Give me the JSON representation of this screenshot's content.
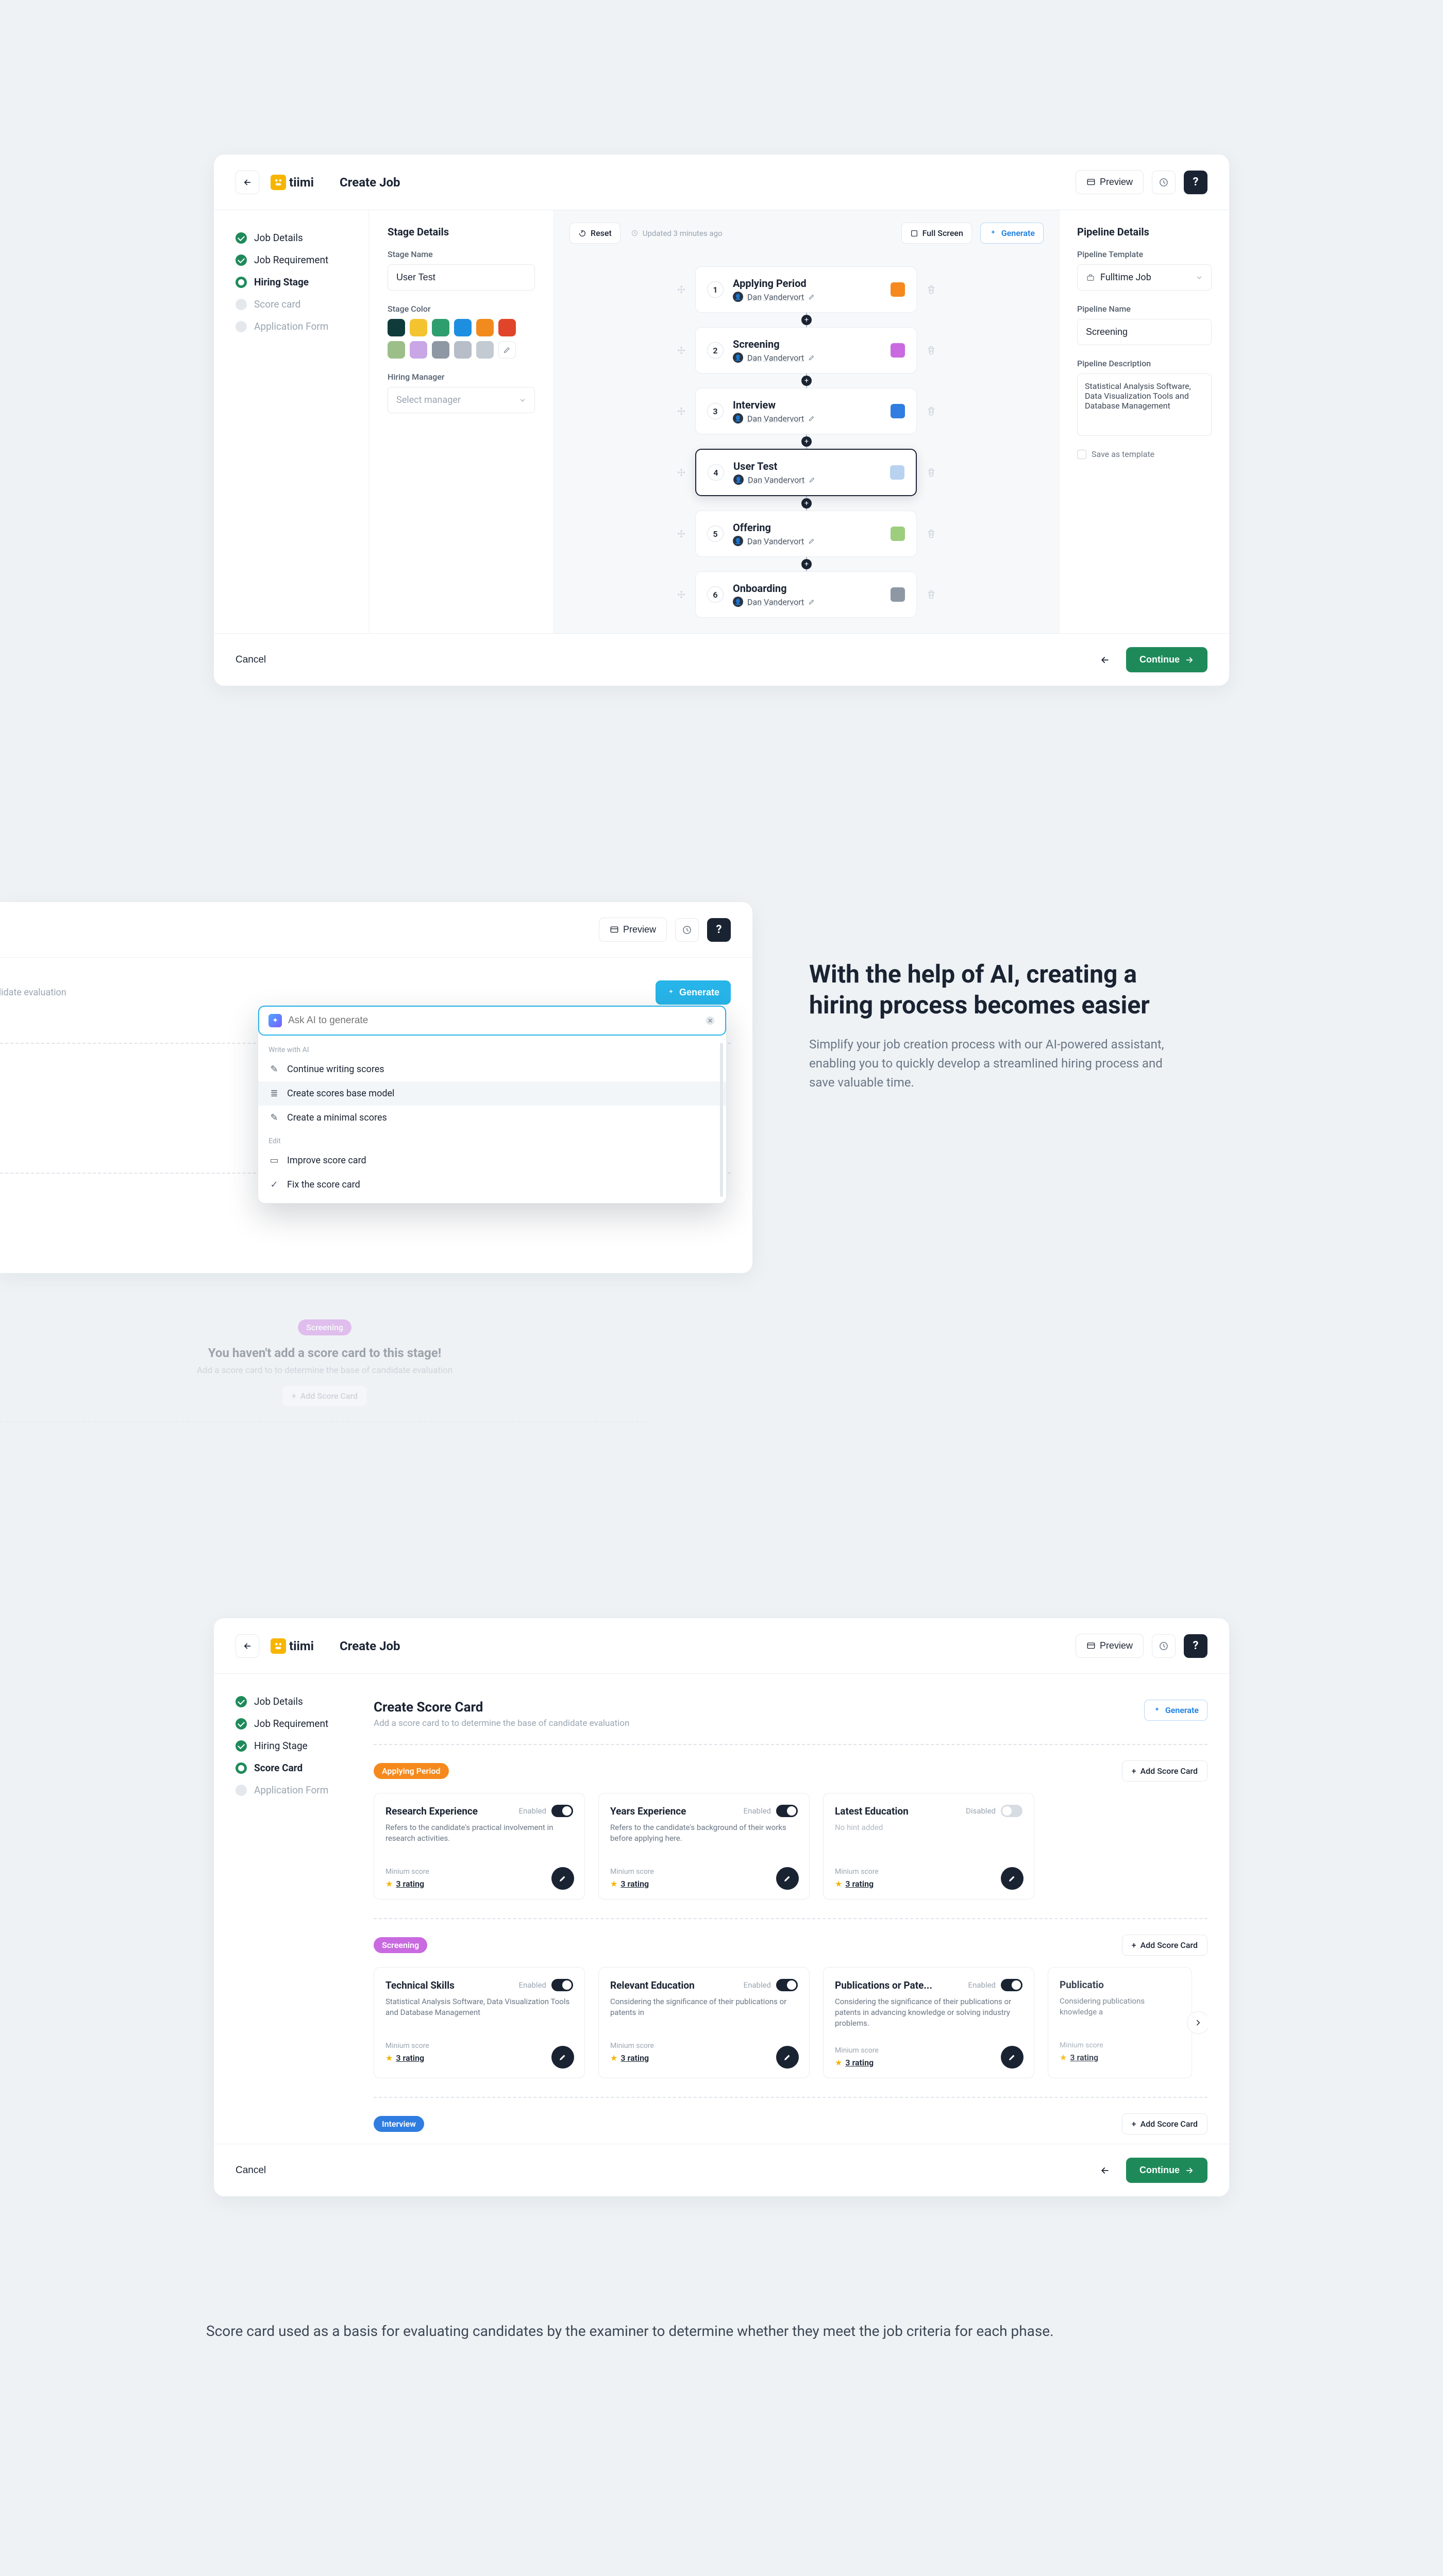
{
  "brand": {
    "name": "tiimi"
  },
  "topbar": {
    "title": "Create Job",
    "preview": "Preview",
    "help": "?",
    "scorePreview": "Preview"
  },
  "nav": {
    "steps": [
      "Job Details",
      "Job Requirement",
      "Hiring Stage",
      "Score card",
      "Application Form"
    ],
    "steps_b": [
      "Job Details",
      "Job Requirement",
      "Hiring Stage",
      "Score Card",
      "Application Form"
    ]
  },
  "stagePanel": {
    "title": "Stage Details",
    "nameLabel": "Stage Name",
    "nameValue": "User Test",
    "colorLabel": "Stage Color",
    "managerLabel": "Hiring Manager",
    "managerPlaceholder": "Select manager",
    "colors": [
      "#0f3b3a",
      "#f4c430",
      "#2f9e6e",
      "#1e8fe0",
      "#f28b1d",
      "#e0452c",
      "#9cbf8a",
      "#c9a7e6",
      "#8e98a4",
      "#b7bec7",
      "#c3cad2"
    ]
  },
  "canvas": {
    "reset": "Reset",
    "updated": "Updated 3 minutes ago",
    "fullscreen": "Full Screen",
    "generate": "Generate",
    "owner": "Dan Vandervort",
    "stages": [
      {
        "num": "1",
        "title": "Applying Period",
        "color": "#f5891d",
        "active": false
      },
      {
        "num": "2",
        "title": "Screening",
        "color": "#c96ae0",
        "active": false
      },
      {
        "num": "3",
        "title": "Interview",
        "color": "#2f7de0",
        "active": false
      },
      {
        "num": "4",
        "title": "User Test",
        "color": "#b9d2f0",
        "active": true
      },
      {
        "num": "5",
        "title": "Offering",
        "color": "#9cce7e",
        "active": false
      },
      {
        "num": "6",
        "title": "Onboarding",
        "color": "#8e98a4",
        "active": false
      }
    ]
  },
  "pipePanel": {
    "title": "Pipeline Details",
    "templateLabel": "Pipeline Template",
    "templateValue": "Fulltime Job",
    "nameLabel": "Pipeline Name",
    "nameValue": "Screening",
    "descLabel": "Pipeline Description",
    "descValue": "Statistical Analysis Software, Data Visualization Tools and Database Management",
    "saveTemplate": "Save as template"
  },
  "footer": {
    "cancel": "Cancel",
    "continue": "Continue"
  },
  "ai": {
    "headline": "With the help of AI, creating a hiring process becomes easier",
    "sub": "Simplify your job creation process with our AI-powered assistant, enabling you to quickly develop a streamlined hiring process and save valuable time.",
    "preview": "Preview",
    "evalTrail": "didate evaluation",
    "generate": "Generate",
    "input_placeholder": "Ask AI to generate",
    "group_write": "Write with AI",
    "continue": "Continue writing scores",
    "create_base": "Create scores base model",
    "create_min": "Create a minimal scores",
    "group_edit": "Edit",
    "improve": "Improve score card",
    "fix": "Fix the score card",
    "lane1_tag": "Applying Period",
    "lane_empty_title": "You haven't add a score card to this stage!",
    "lane_empty_sub": "Add a score card to to determine the base of candidate evaluation",
    "lane_empty_title_trunc": "You haven't add a score ca",
    "lane_empty_sub_trunc": "Add a score card to to determine the base",
    "add_score_trunc": "Add Score Car",
    "add_score": "Add Score Card",
    "lane2_tag": "Screening"
  },
  "scorecard": {
    "title": "Create Score Card",
    "sub": "Add a score card to to determine the base of candidate evaluation",
    "generate": "Generate",
    "addScore": "Add Score Card",
    "min": "Minium score",
    "rating": "3 rating",
    "enabled": "Enabled",
    "disabled": "Disabled",
    "noHintAdded": "No hint added",
    "partialCardName": "Publicatio",
    "lane1": {
      "tag": "Applying Period",
      "cards": [
        {
          "name": "Research Experience",
          "state": "Enabled",
          "on": true,
          "desc": "Refers to the candidate's practical involvement in research activities."
        },
        {
          "name": "Years Experience",
          "state": "Enabled",
          "on": true,
          "desc": "Refers to the candidate's background of their works before applying here."
        },
        {
          "name": "Latest Education",
          "state": "Disabled",
          "on": false,
          "desc": "No hint added"
        }
      ]
    },
    "lane2": {
      "tag": "Screening",
      "cards": [
        {
          "name": "Technical Skills",
          "state": "Enabled",
          "on": true,
          "desc": "Statistical Analysis Software, Data Visualization Tools and Database Management"
        },
        {
          "name": "Relevant Education",
          "state": "Enabled",
          "on": true,
          "desc": "Considering the significance of their publications or patents in"
        },
        {
          "name": "Publications or Pate...",
          "state": "Enabled",
          "on": true,
          "desc": "Considering the significance of their publications or patents in advancing knowledge or solving industry problems."
        }
      ],
      "partialDesc": "Considering publications knowledge a"
    },
    "lane3": {
      "tag": "Interview"
    }
  },
  "caption": "Score card used as a basis for evaluating candidates by the examiner to determine whether they meet the job criteria for each phase."
}
